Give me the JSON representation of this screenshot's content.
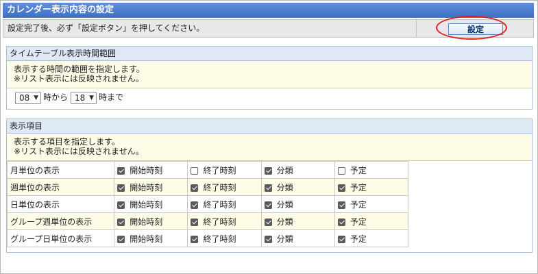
{
  "page": {
    "title": "カレンダー表示内容の設定"
  },
  "instruction": {
    "text": "設定完了後、必ず「設定ボタン」を押してください。",
    "set_button": "設定"
  },
  "timetable": {
    "heading": "タイムテーブル表示時間範囲",
    "desc_line1": "表示する時間の範囲を指定します。",
    "desc_line2": "※リスト表示には反映されません。",
    "from_value": "08",
    "from_suffix": "時から",
    "to_value": "18",
    "to_suffix": "時まで"
  },
  "display_items": {
    "heading": "表示項目",
    "desc_line1": "表示する項目を指定します。",
    "desc_line2": "※リスト表示には反映されません。",
    "columns": [
      "開始時刻",
      "終了時刻",
      "分類",
      "予定"
    ],
    "rows": [
      {
        "label": "月単位の表示",
        "checked": [
          true,
          false,
          true,
          false
        ]
      },
      {
        "label": "週単位の表示",
        "checked": [
          true,
          true,
          true,
          true
        ]
      },
      {
        "label": "日単位の表示",
        "checked": [
          true,
          true,
          true,
          true
        ]
      },
      {
        "label": "グループ週単位の表示",
        "checked": [
          true,
          true,
          true,
          true
        ]
      },
      {
        "label": "グループ日単位の表示",
        "checked": [
          true,
          true,
          true,
          true
        ]
      }
    ]
  },
  "colors": {
    "title_bar": "#4a7bcc",
    "highlight_oval": "#e02020",
    "row_alt": "#fefbe6"
  }
}
